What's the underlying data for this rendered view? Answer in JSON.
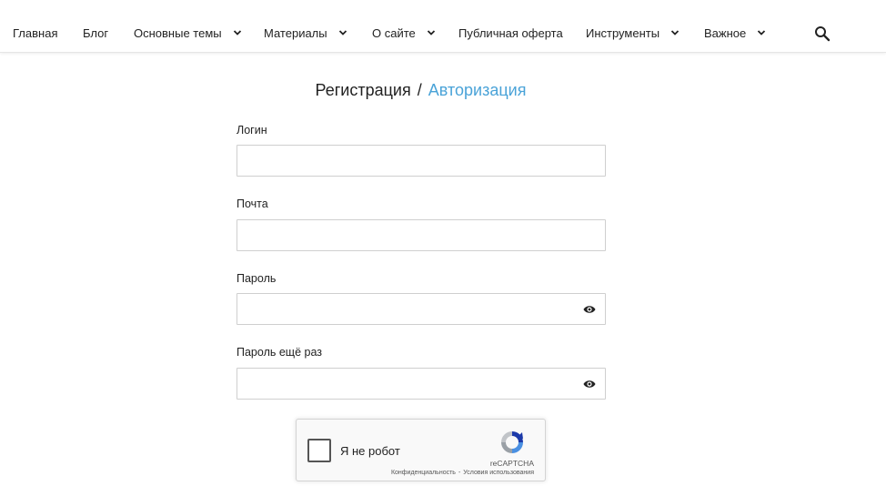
{
  "nav": {
    "items": [
      {
        "label": "Главная",
        "dropdown": false
      },
      {
        "label": "Блог",
        "dropdown": false
      },
      {
        "label": "Основные темы",
        "dropdown": true
      },
      {
        "label": "Материалы",
        "dropdown": true
      },
      {
        "label": "О сайте",
        "dropdown": true
      },
      {
        "label": "Публичная оферта",
        "dropdown": false
      },
      {
        "label": "Инструменты",
        "dropdown": true
      },
      {
        "label": "Важное",
        "dropdown": true
      }
    ],
    "search_icon": "search-icon"
  },
  "form": {
    "title_register": "Регистрация",
    "title_separator": "/",
    "title_login": "Авторизация",
    "login_label": "Логин",
    "login_value": "",
    "email_label": "Почта",
    "email_value": "",
    "password_label": "Пароль",
    "password_value": "",
    "password_repeat_label": "Пароль ещё раз",
    "password_repeat_value": ""
  },
  "captcha": {
    "label": "Я не робот",
    "brand": "reCAPTCHA",
    "privacy": "Конфиденциальность",
    "dot": "-",
    "terms": "Условия использования"
  },
  "colors": {
    "link": "#4aa3d8",
    "text": "#222222",
    "border": "#cfcfcf"
  }
}
